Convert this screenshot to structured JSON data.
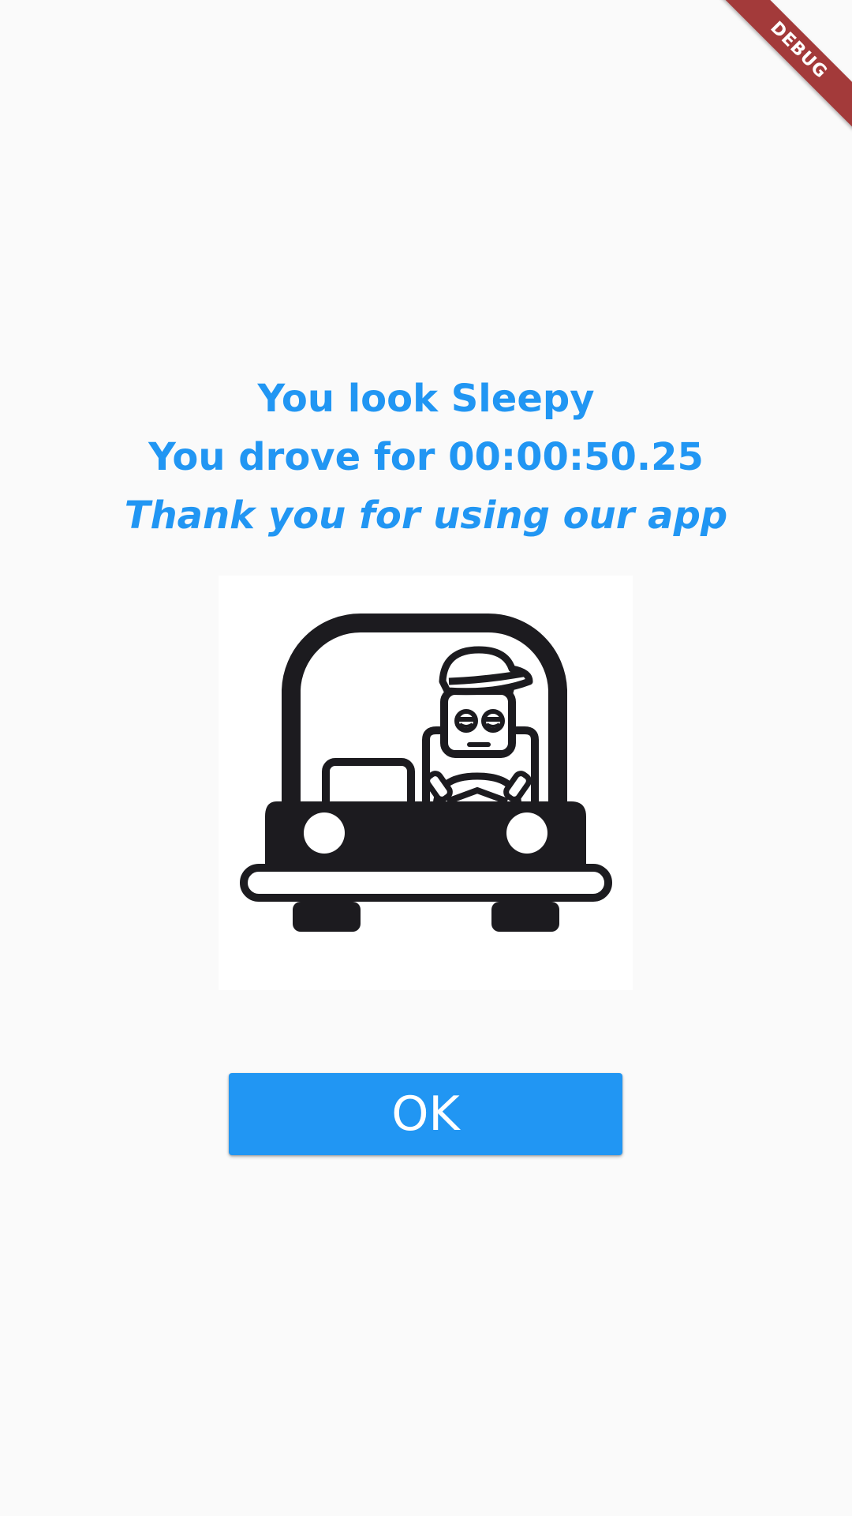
{
  "debug_banner": {
    "label": "DEBUG",
    "color": "#a33a3a"
  },
  "message": {
    "status": "You look Sleepy",
    "duration": "You drove for 00:00:50.25",
    "thanks": "Thank you for using our app",
    "color": "#2196f3"
  },
  "illustration": {
    "icon": "sleepy-driver-car-icon"
  },
  "actions": {
    "ok_label": "OK",
    "ok_color": "#2196f3"
  }
}
